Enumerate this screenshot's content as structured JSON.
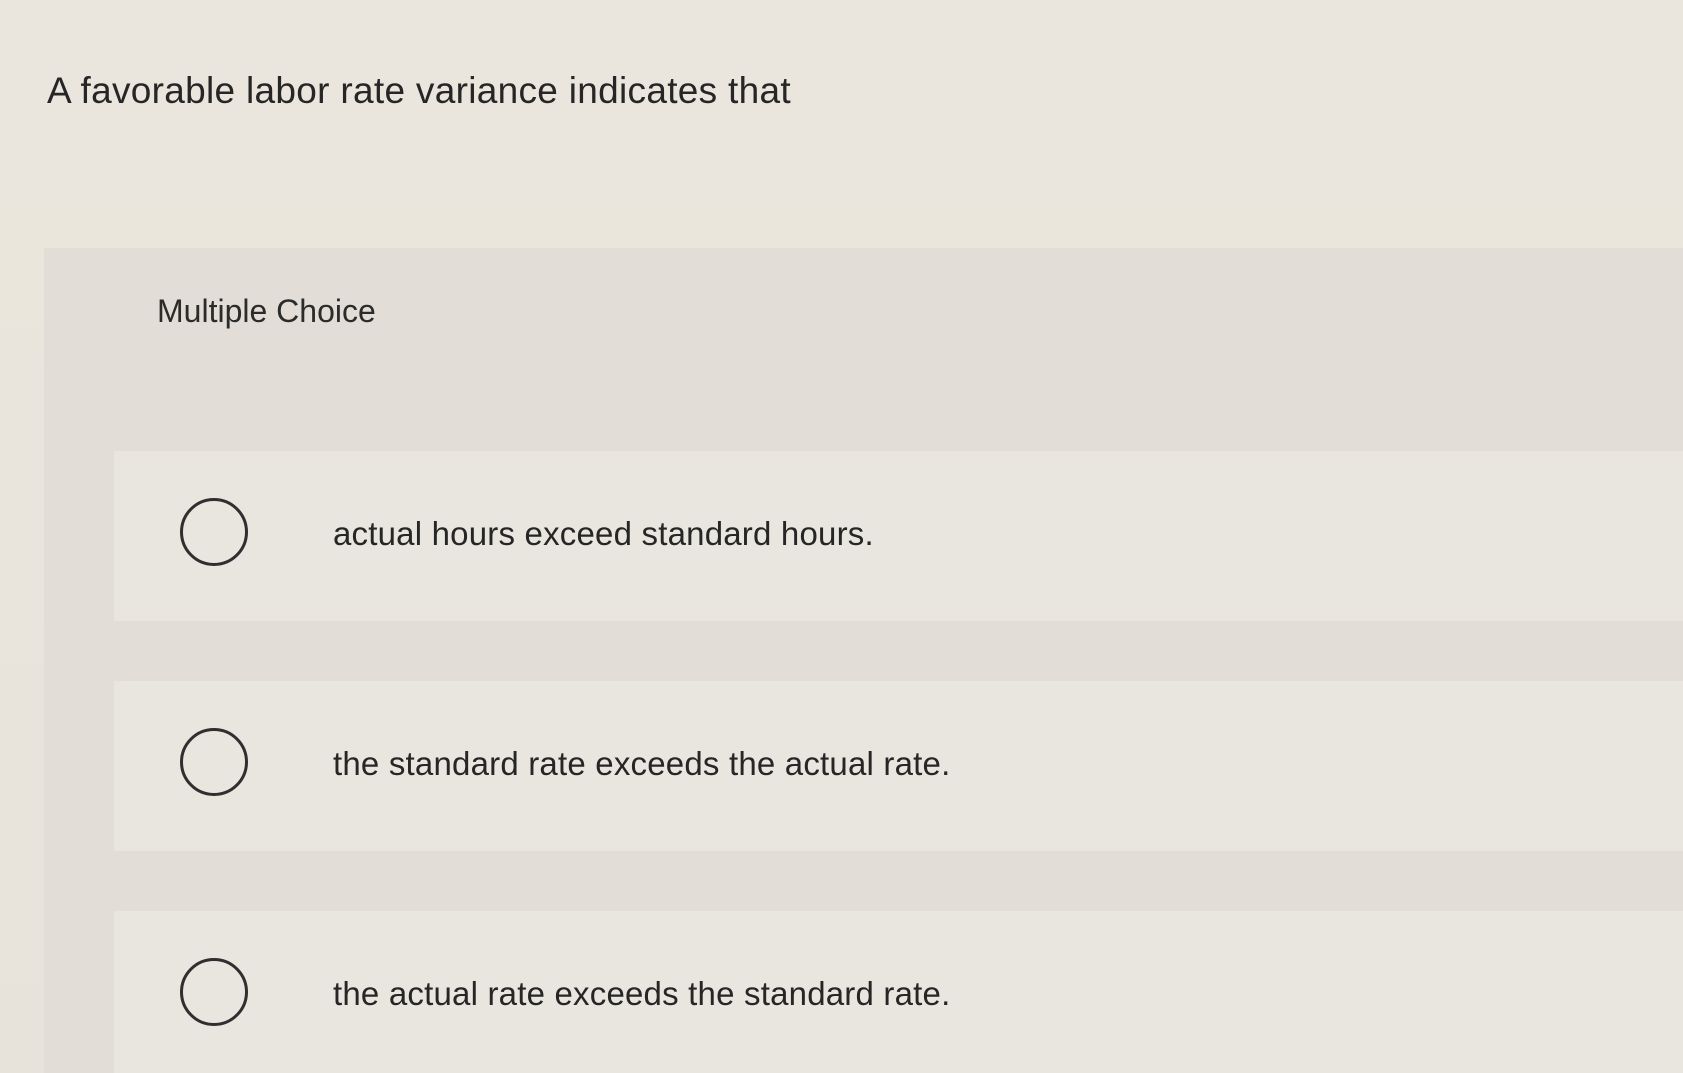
{
  "question": {
    "text": "A favorable labor rate variance indicates that"
  },
  "panel": {
    "label": "Multiple Choice"
  },
  "options": [
    {
      "text": "actual hours exceed standard hours.",
      "selected": false
    },
    {
      "text": "the standard rate exceeds the actual rate.",
      "selected": false
    },
    {
      "text": "the actual rate exceeds the standard rate.",
      "selected": false
    }
  ]
}
